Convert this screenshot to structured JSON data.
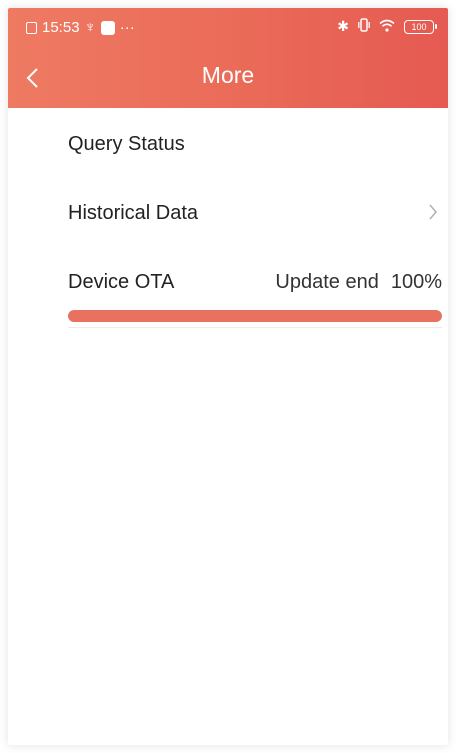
{
  "statusbar": {
    "time": "15:53",
    "usb_symbol": "♆",
    "more": "···",
    "bluetooth": "✱",
    "wifi": "◠",
    "battery": "100"
  },
  "header": {
    "title": "More",
    "back_icon": "chevron-left-icon"
  },
  "menu": {
    "items": [
      {
        "label": "Query Status",
        "has_chevron": false
      },
      {
        "label": "Historical Data",
        "has_chevron": true
      }
    ],
    "ota": {
      "label": "Device OTA",
      "status_text": "Update end",
      "percent_text": "100%",
      "progress": 1.0
    }
  },
  "colors": {
    "header_start": "#ee7a62",
    "header_end": "#e55a52",
    "progress": "#e8715f"
  }
}
